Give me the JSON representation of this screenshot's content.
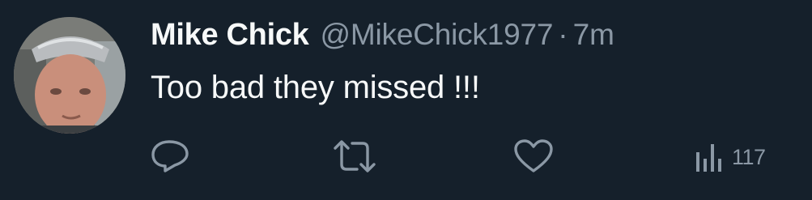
{
  "tweet": {
    "author_name": "Mike Chick",
    "author_handle": "@MikeChick1977",
    "separator": "·",
    "timestamp": "7m",
    "text": "Too bad they missed !!!"
  },
  "actions": {
    "reply_icon": "reply-icon",
    "retweet_icon": "retweet-icon",
    "like_icon": "heart-icon",
    "views_icon": "views-icon",
    "views_count": "117"
  },
  "colors": {
    "background": "#15202b",
    "primary_text": "#f7f9f9",
    "secondary_text": "#8b98a5"
  }
}
